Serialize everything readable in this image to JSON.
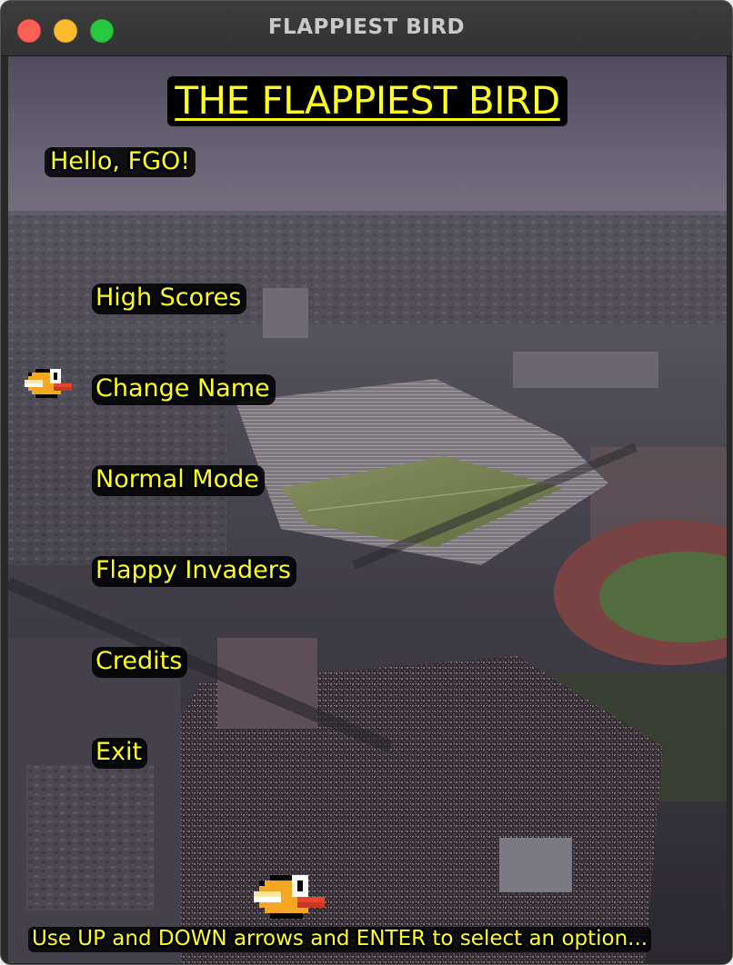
{
  "window": {
    "title": "FLAPPIEST BIRD"
  },
  "game": {
    "title": "THE FLAPPIEST BIRD",
    "greeting": "Hello, FGO!",
    "menu": [
      {
        "label": "High Scores"
      },
      {
        "label": "Change Name"
      },
      {
        "label": "Normal Mode"
      },
      {
        "label": "Flappy Invaders"
      },
      {
        "label": "Credits"
      },
      {
        "label": "Exit"
      }
    ],
    "selected_index": 1,
    "hint": "Use UP and DOWN arrows and ENTER to select an option..."
  },
  "colors": {
    "text": "#ffff1e",
    "text_outline": "#000000",
    "bird_body": "#f5a623",
    "bird_beak": "#e8452c"
  },
  "icons": {
    "selector": "flappy-bird-icon",
    "mascot": "flappy-bird-icon"
  }
}
